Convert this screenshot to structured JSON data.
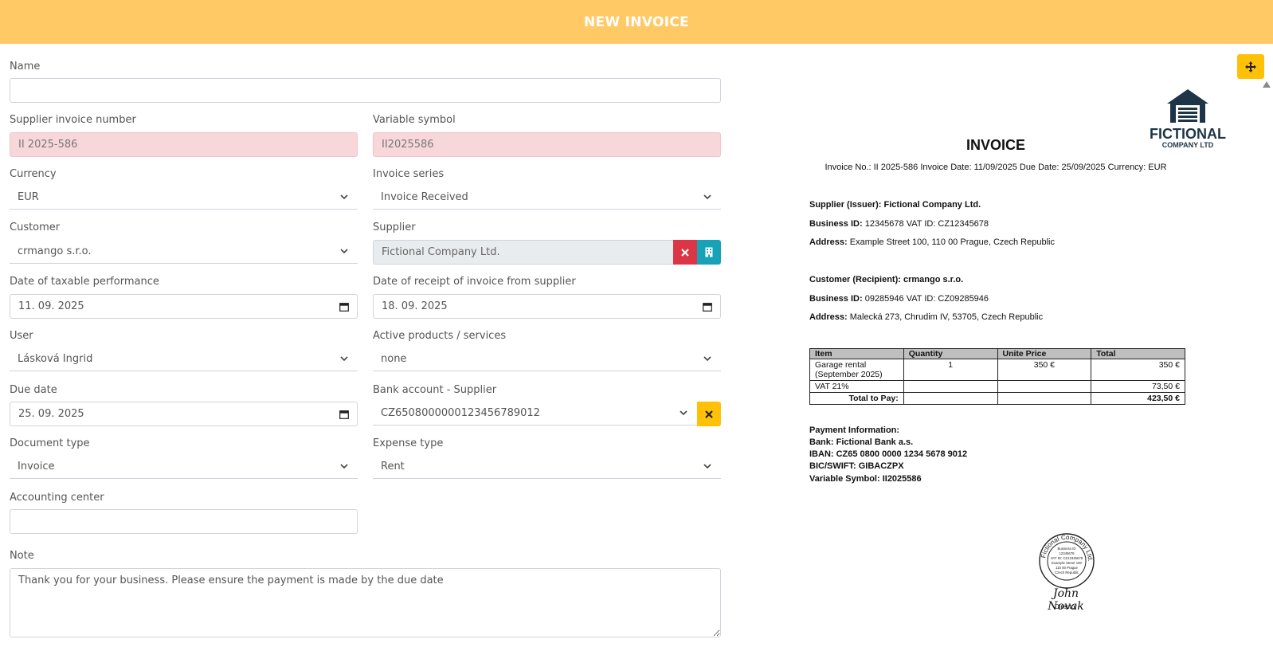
{
  "header": {
    "title": "NEW INVOICE"
  },
  "form": {
    "name": {
      "label": "Name",
      "value": ""
    },
    "supplier_invoice_number": {
      "label": "Supplier invoice number",
      "value": "II 2025-586"
    },
    "variable_symbol": {
      "label": "Variable symbol",
      "value": "II2025586"
    },
    "currency": {
      "label": "Currency",
      "value": "EUR"
    },
    "invoice_series": {
      "label": "Invoice series",
      "value": "Invoice Received"
    },
    "customer": {
      "label": "Customer",
      "value": "crmango s.r.o."
    },
    "supplier": {
      "label": "Supplier",
      "value": "Fictional Company Ltd."
    },
    "date_taxable": {
      "label": "Date of taxable performance",
      "value": "11. 09. 2025"
    },
    "date_receipt": {
      "label": "Date of receipt of invoice from supplier",
      "value": "18. 09. 2025"
    },
    "user": {
      "label": "User",
      "value": "Lásková Ingrid"
    },
    "active_products": {
      "label": "Active products / services",
      "value": "none"
    },
    "due_date": {
      "label": "Due date",
      "value": "25. 09. 2025"
    },
    "bank_account": {
      "label": "Bank account - Supplier",
      "value": "CZ6508000000123456789012"
    },
    "document_type": {
      "label": "Document type",
      "value": "Invoice"
    },
    "expense_type": {
      "label": "Expense type",
      "value": "Rent"
    },
    "accounting_center": {
      "label": "Accounting center",
      "value": ""
    },
    "note": {
      "label": "Note",
      "value": "Thank you for your business. Please ensure the payment is made by the due date"
    }
  },
  "colors": {
    "header": "#ffc966",
    "invalid": "#f8d7da",
    "danger": "#dc3545",
    "info": "#17a2b8",
    "warning": "#ffc107"
  },
  "icons": {
    "move": "move-icon",
    "remove": "close-icon",
    "company": "building-icon",
    "dropdown": "chevron-down-icon",
    "calendar": "calendar-icon"
  },
  "document": {
    "logo": {
      "line1": "FICTIONAL",
      "line2": "COMPANY LTD"
    },
    "title": "INVOICE",
    "meta": "Invoice No.: II 2025-586 Invoice Date: 11/09/2025 Due Date: 25/09/2025 Currency: EUR",
    "supplier_heading": "Supplier (Issuer): Fictional Company Ltd.",
    "supplier_ids_label": "Business ID:",
    "supplier_ids": "12345678 VAT ID: CZ12345678",
    "supplier_address_label": "Address:",
    "supplier_address": "Example Street 100, 110 00 Prague, Czech Republic",
    "customer_heading": "Customer (Recipient): crmango s.r.o.",
    "customer_ids_label": "Business ID:",
    "customer_ids": "09285946  VAT ID: CZ09285946",
    "customer_address_label": "Address:",
    "customer_address": "Malecká 273, Chrudim IV, 53705, Czech Republic",
    "table": {
      "headers": [
        "Item",
        "Quantity",
        "Unite Price",
        "Total"
      ],
      "rows": [
        {
          "item": "Garage rental (September 2025)",
          "quantity": "1",
          "price": "350 €",
          "total": "350 €"
        },
        {
          "item": "VAT 21%",
          "quantity": "",
          "price": "",
          "total": "73,50 €"
        }
      ],
      "total_label": "Total to Pay:",
      "total_value": "423,50 €"
    },
    "payment": {
      "heading": "Payment Information:",
      "bank": "Bank: Fictional Bank a.s.",
      "iban": "IBAN: CZ65 0800 0000 1234 5678 9012",
      "bic": "BIC/SWIFT: GIBACZPX",
      "vs": "Variable Symbol: II2025586"
    },
    "stamp": {
      "ring": "Fictional Company Ltd.",
      "lines": [
        "Business ID",
        "12345678",
        "VAT ID: CZ12345678",
        "Example Street 100",
        "110 00 Prague",
        "Czech Republic"
      ]
    },
    "signature": "John Novak",
    "signature_role": "Director"
  }
}
